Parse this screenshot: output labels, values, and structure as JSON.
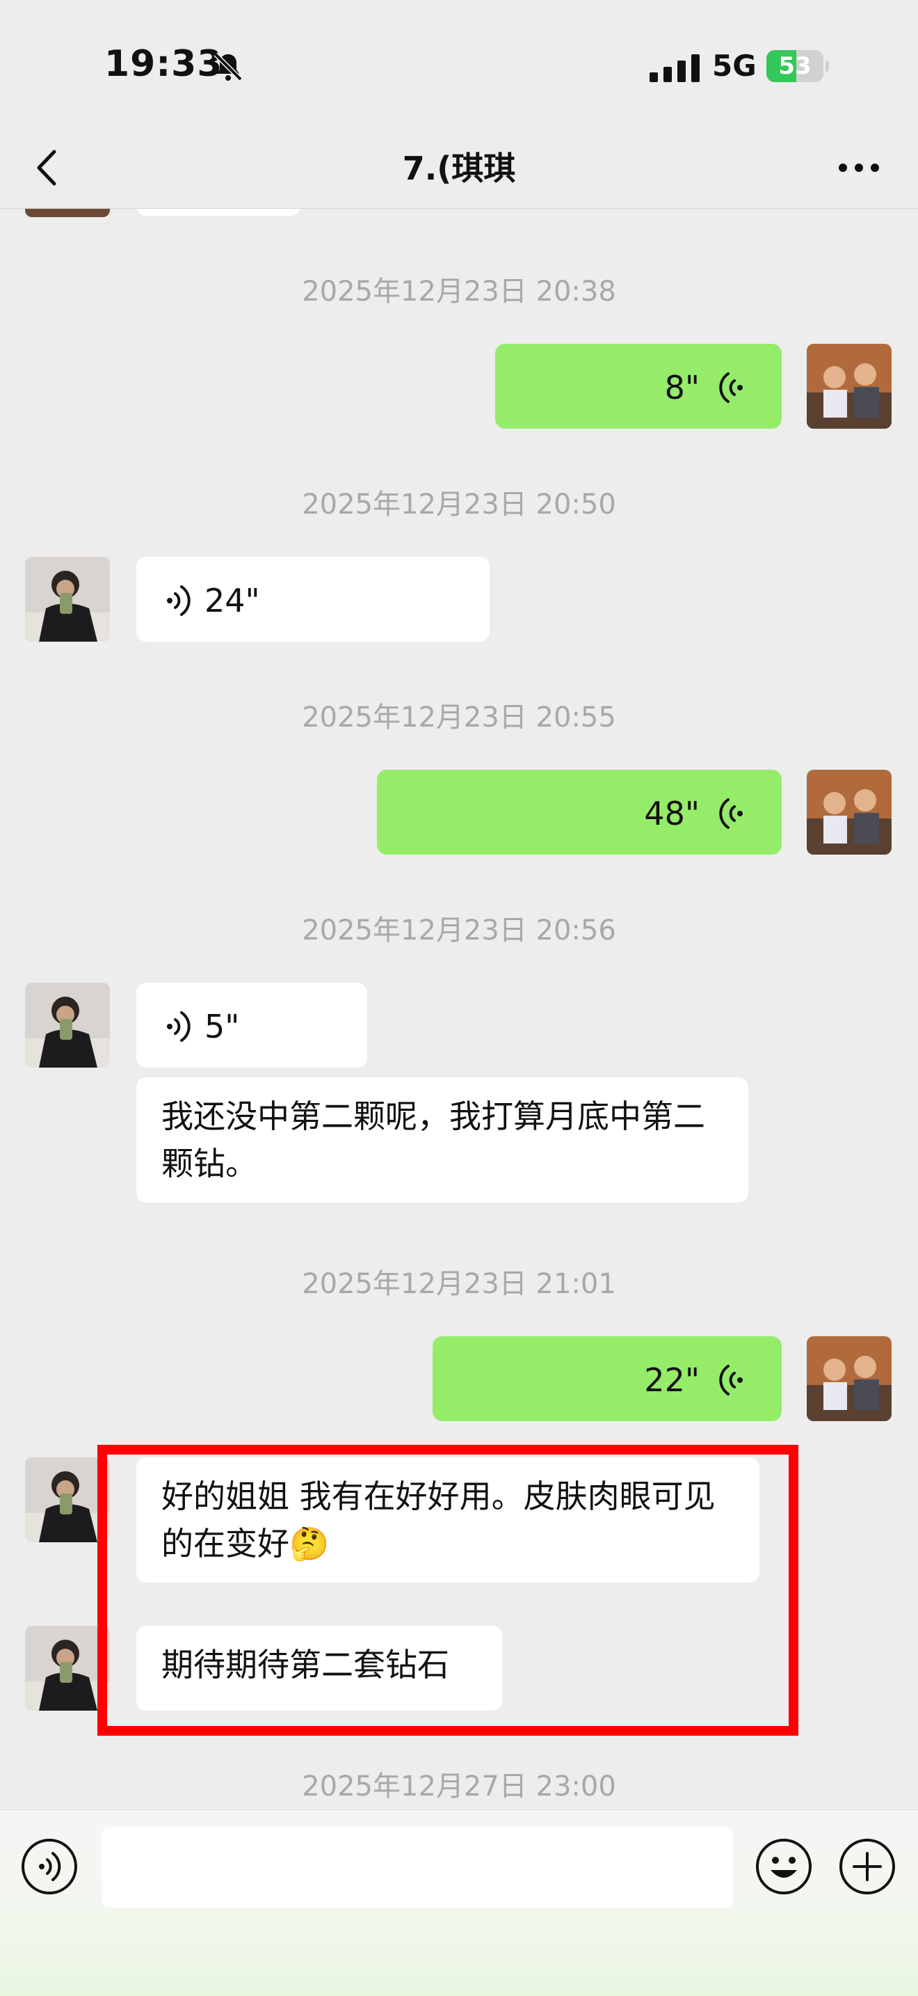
{
  "status_bar": {
    "time": "19:33",
    "network": "5G",
    "battery": "53",
    "battery_level": 0.53
  },
  "nav": {
    "title": "7.(琪琪"
  },
  "messages": {
    "ts1": "2025年12月23日 20:38",
    "voice_out_1": "8\"",
    "ts2": "2025年12月23日 20:50",
    "voice_in_1": "24\"",
    "ts3": "2025年12月23日 20:55",
    "voice_out_2": "48\"",
    "ts4": "2025年12月23日 20:56",
    "voice_in_2": "5\"",
    "text_in_1": "我还没中第二颗呢，我打算月底中第二颗钻。",
    "ts5": "2025年12月23日 21:01",
    "voice_out_3": "22\"",
    "text_in_2": "好的姐姐 我有在好好用。皮肤肉眼可见的在变好🤔",
    "text_in_3": "期待期待第二套钻石",
    "ts6": "2025年12月27日 23:00"
  },
  "input": {
    "value": ""
  },
  "colors": {
    "out_bubble": "#95ec69",
    "in_bubble": "#ffffff",
    "highlight": "#ff0000",
    "battery": "#34c759"
  },
  "icons": [
    "bell-slash-icon",
    "signal-icon",
    "battery-icon",
    "back-icon",
    "more-icon",
    "voice-wave-icon",
    "voice-toggle-icon",
    "emoji-icon",
    "plus-icon"
  ]
}
